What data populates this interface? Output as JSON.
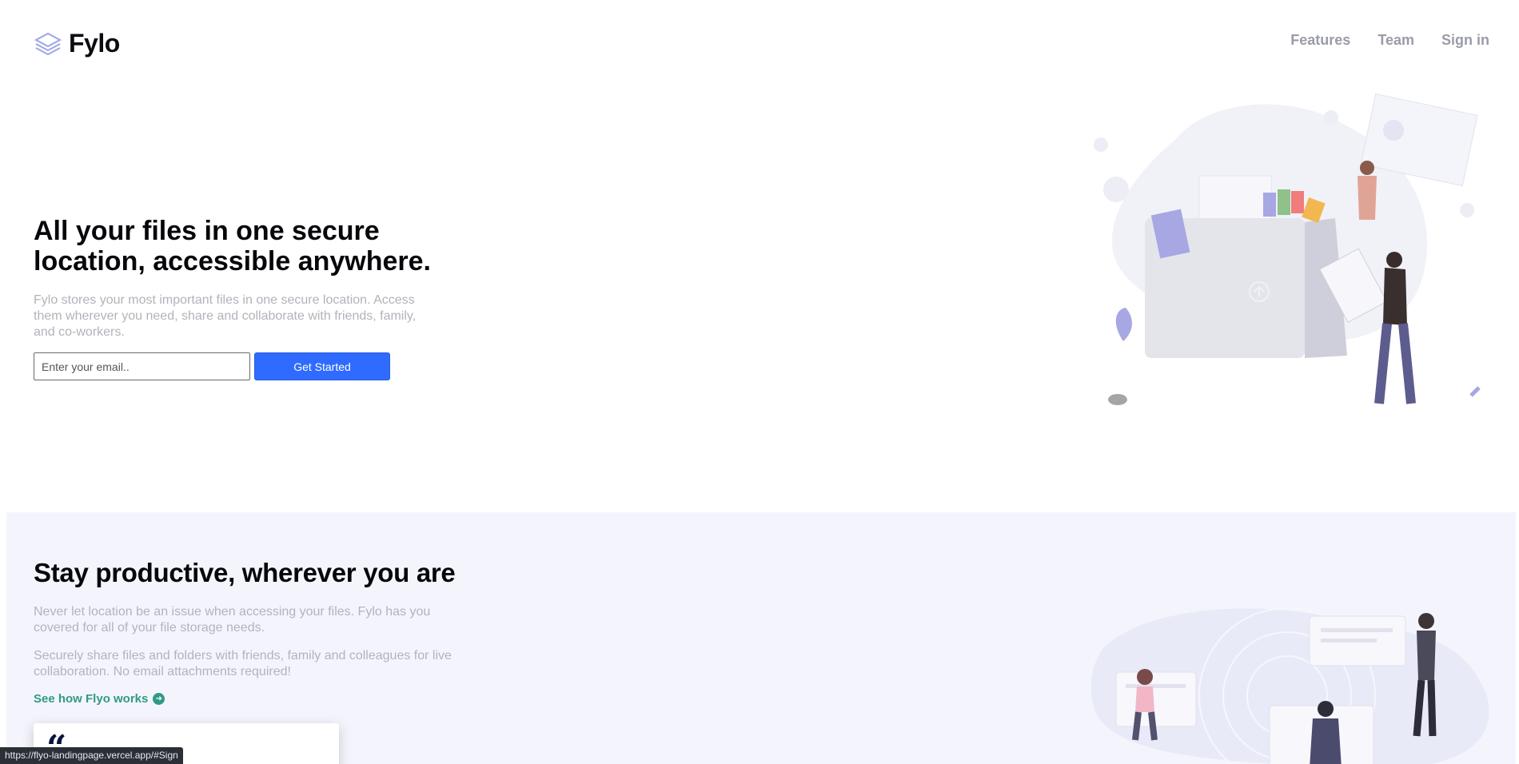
{
  "header": {
    "logo_text": "Fylo",
    "nav": [
      "Features",
      "Team",
      "Sign in"
    ]
  },
  "hero": {
    "title": "All your files in one secure location, accessible anywhere.",
    "description": "Fylo stores your most important files in one secure location. Access them wherever you need, share and collaborate with friends, family, and co-workers.",
    "email_placeholder": "Enter your email..",
    "button_label": "Get Started"
  },
  "productive": {
    "title": "Stay productive, wherever you are",
    "p1": "Never let location be an issue when accessing your files. Fylo has you covered for all of your file storage needs.",
    "p2": "Securely share files and folders with friends, family and colleagues for live collaboration. No email attachments required!",
    "link_text": "See how Flyo works",
    "quote_mark": "“"
  },
  "status_bar": {
    "url": "https://flyo-landingpage.vercel.app/#Sign"
  },
  "colors": {
    "accent_blue": "#2f6bff",
    "link_teal": "#2f9a86",
    "nav_gray": "#9a9ca8",
    "section_bg": "#f4f5fc"
  }
}
